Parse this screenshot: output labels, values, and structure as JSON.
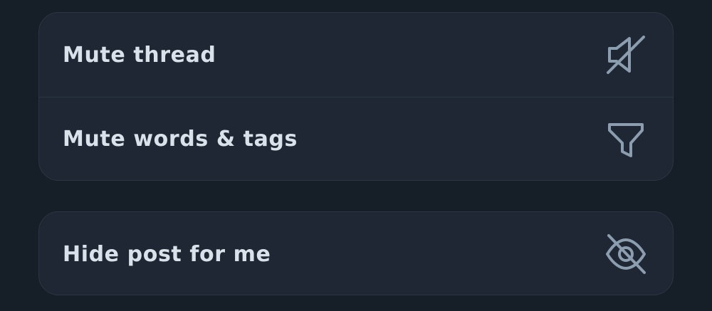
{
  "menu": {
    "groups": [
      {
        "items": [
          {
            "label": "Mute thread",
            "icon": "speaker-mute-icon"
          },
          {
            "label": "Mute words & tags",
            "icon": "filter-icon"
          }
        ]
      },
      {
        "items": [
          {
            "label": "Hide post for me",
            "icon": "eye-slash-icon"
          }
        ]
      }
    ]
  },
  "colors": {
    "background": "#161e27",
    "card": "#1e2733",
    "border": "#2b3644",
    "text": "#d9e1ea",
    "icon": "#8d9db0"
  }
}
